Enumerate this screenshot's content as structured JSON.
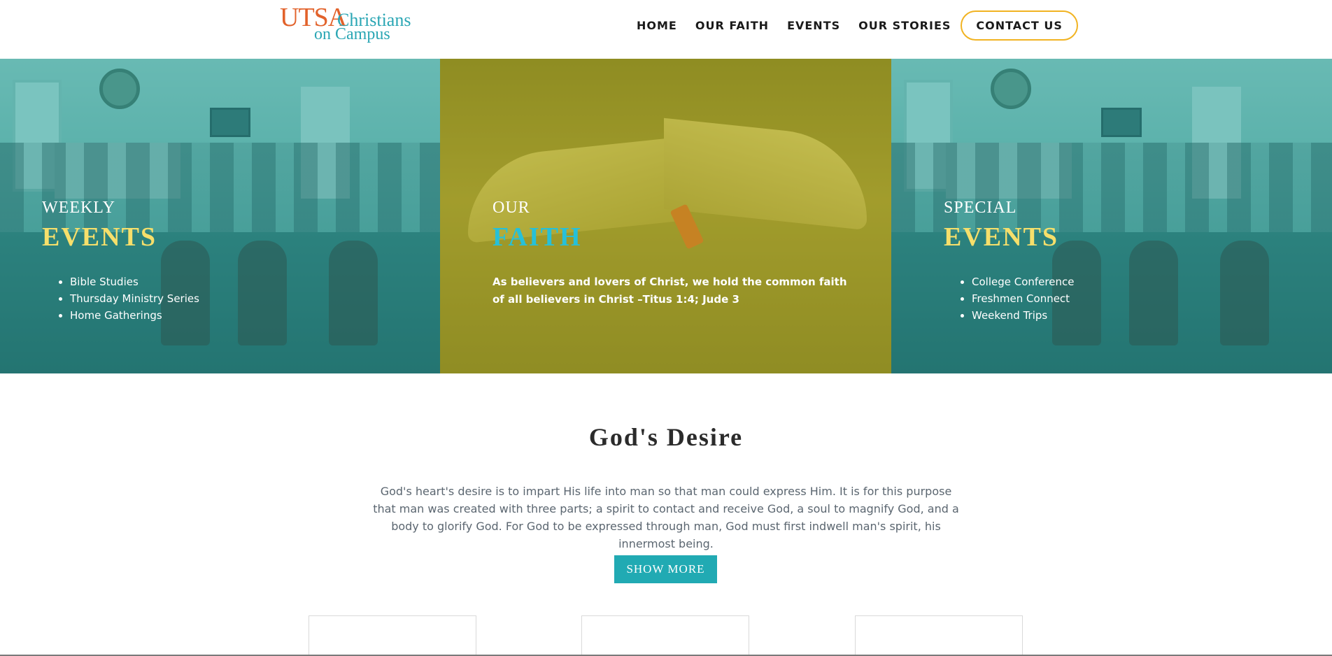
{
  "logo": {
    "utsa": "UTSA",
    "christians": "Christians",
    "on_campus": "on Campus",
    "colors": {
      "utsa": "#e2622b",
      "christians": "#2aa6b4"
    }
  },
  "nav": {
    "items": [
      "HOME",
      "OUR FAITH",
      "EVENTS",
      "OUR STORIES"
    ],
    "contact": "CONTACT US",
    "contact_border_color": "#f1b322"
  },
  "hero": {
    "weekly": {
      "sub": "WEEKLY",
      "title": "EVENTS",
      "items": [
        "Bible Studies",
        "Thursday Ministry Series",
        "Home Gatherings"
      ]
    },
    "faith": {
      "sub": "OUR",
      "title": "FAITH",
      "text": "As believers and lovers of Christ, we hold the common faith of all believers in Christ –Titus 1:4; Jude 3"
    },
    "special": {
      "sub": "SPECIAL",
      "title": "EVENTS",
      "items": [
        "College Conference",
        "Freshmen Connect",
        "Weekend Trips"
      ]
    }
  },
  "desire": {
    "title": "God's Desire",
    "text": "God's heart's desire is to impart His life into man so that man could express Him. It is for this purpose that man was created with three parts; a spirit to contact and receive God, a soul to magnify God, and a body to glorify God. For God to be expressed through man, God must first indwell man's spirit, his innermost being.",
    "button": "SHOW MORE",
    "button_color": "#21aab3"
  }
}
